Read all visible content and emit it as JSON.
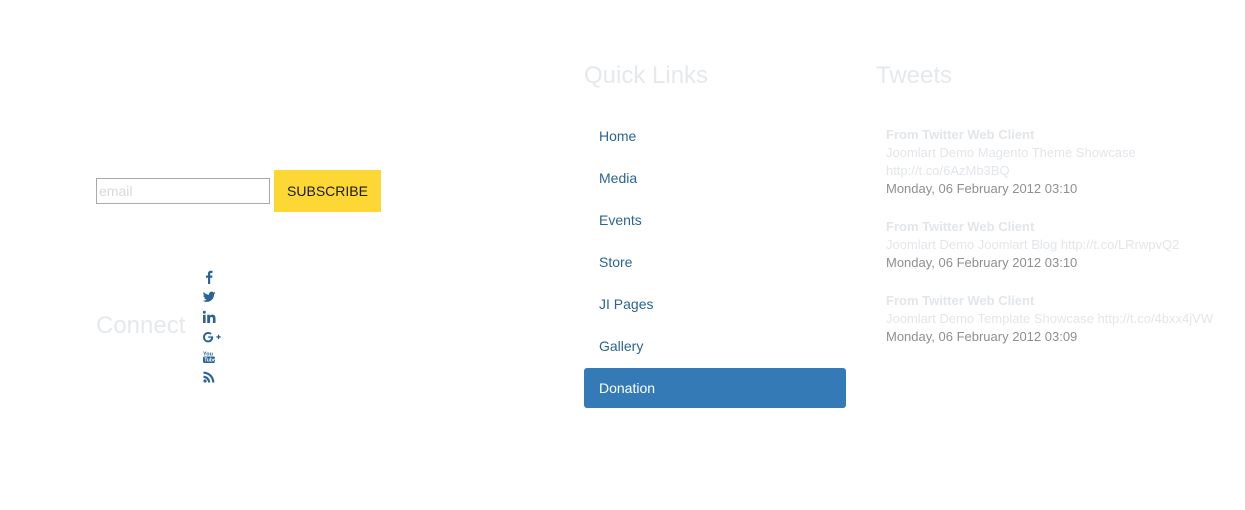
{
  "subscribe": {
    "placeholder": "email",
    "button_label": "SUBSCRIBE",
    "button_color": "#fdd835"
  },
  "connect": {
    "heading": "Connect",
    "icons": [
      "facebook-icon",
      "twitter-icon",
      "linkedin-icon",
      "google-plus-icon",
      "youtube-icon",
      "rss-icon"
    ],
    "icon_color": "#2a6496"
  },
  "quick_links": {
    "heading": "Quick Links",
    "items": [
      {
        "label": "Home"
      },
      {
        "label": "Media"
      },
      {
        "label": "Events"
      },
      {
        "label": "Store"
      },
      {
        "label": "JI Pages"
      },
      {
        "label": "Gallery"
      },
      {
        "label": "Donation"
      }
    ],
    "active_index": 6,
    "active_color": "#337ab7"
  },
  "tweets": {
    "heading": "Tweets",
    "items": [
      {
        "source": "From Twitter Web Client",
        "text": "Joomlart Demo Magento Theme Showcase",
        "link": "http://t.co/6AzMb3BQ",
        "date": "Monday, 06 February 2012 03:10"
      },
      {
        "source": "From Twitter Web Client",
        "text": "Joomlart Demo Joomlart Blog",
        "link": "http://t.co/LRrwpvQ2",
        "date": "Monday, 06 February 2012 03:10"
      },
      {
        "source": "From Twitter Web Client",
        "text": "Joomlart Demo Template Showcase",
        "link": "http://t.co/4bxx4jVW",
        "date": "Monday, 06 February 2012 03:09"
      }
    ]
  }
}
